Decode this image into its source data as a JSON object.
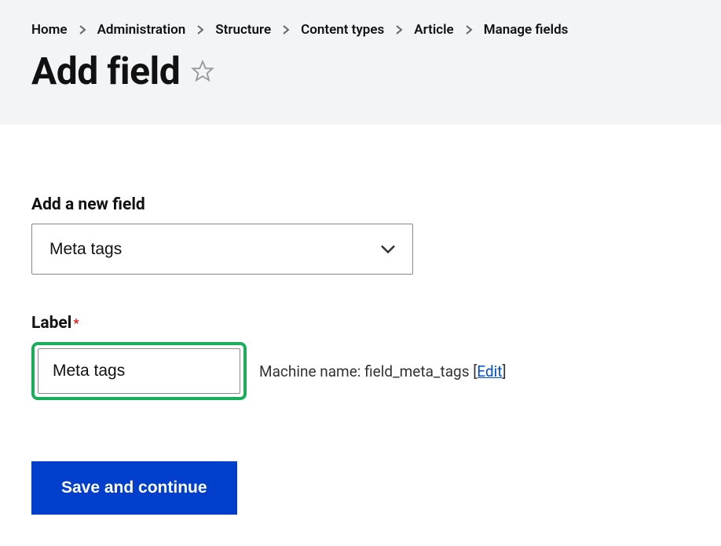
{
  "breadcrumb": {
    "home": "Home",
    "administration": "Administration",
    "structure": "Structure",
    "content_types": "Content types",
    "article": "Article",
    "manage_fields": "Manage fields"
  },
  "page_title": "Add field",
  "form": {
    "new_field_label": "Add a new field",
    "new_field_value": "Meta tags",
    "label_label": "Label",
    "label_value": "Meta tags",
    "machine_name_prefix": "Machine name: ",
    "machine_name_value": "field_meta_tags",
    "edit_link": "Edit",
    "submit": "Save and continue"
  }
}
